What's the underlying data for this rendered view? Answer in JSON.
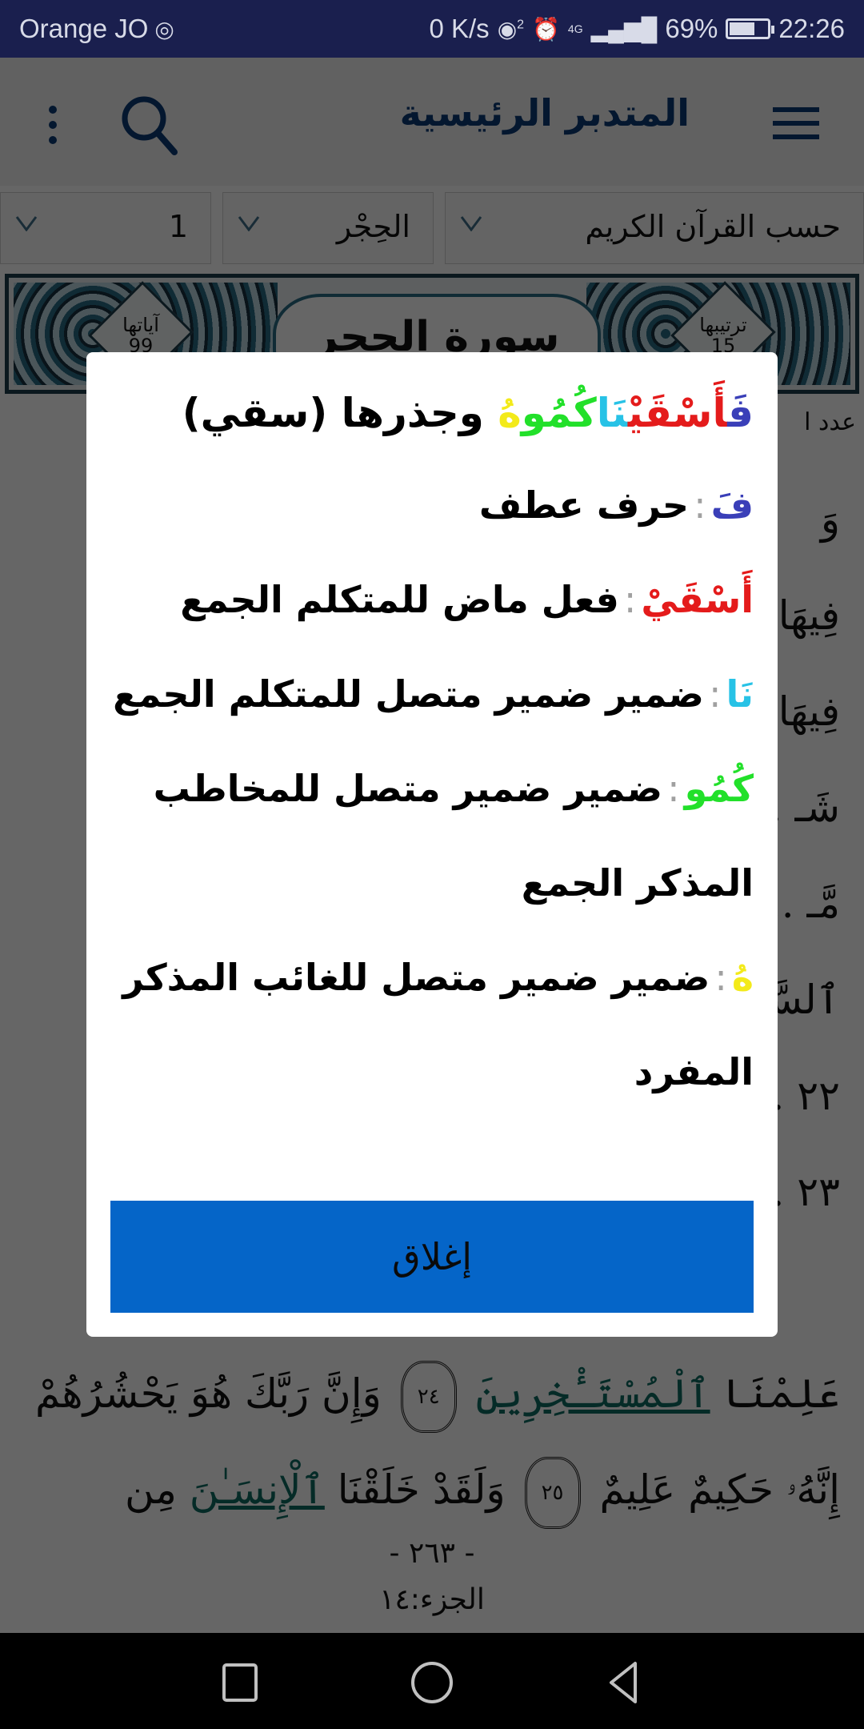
{
  "status_bar": {
    "carrier": "Orange JO",
    "net_speed": "0 K/s",
    "hotspot_count": "2",
    "network_type": "4G",
    "battery_percent": "69%",
    "battery_level": 0.69,
    "time": "22:26"
  },
  "app_bar": {
    "title": "المتدبر الرئيسية",
    "icons": [
      "menu-icon",
      "search-icon",
      "more-vert-icon"
    ]
  },
  "selectors": {
    "mode": "حسب القرآن الكريم",
    "surah": "الحِجْر",
    "number": "1"
  },
  "surah_banner": {
    "title": "سورة الحجر",
    "ayah_count_label": "آياتها",
    "ayah_count": "99",
    "order_label": "ترتيبها",
    "order": "15"
  },
  "page": {
    "info_line": "عدد ا",
    "lines": [
      "وَ",
      "فِيهَا ... كُمْ",
      "فِيهَا ... مِّن",
      "شَـ ... رٍ",
      "مَّـ ... نَ",
      "ٱلسَّـ ... ينَ",
      "٢٢ ... ونَ",
      "٢٣ ... قَدْ"
    ],
    "line_10": {
      "before": "عَلِمْنَا",
      "highlight": "ٱلْمُسْتَـْٔخِرِينَ",
      "ayah_number": "٢٤",
      "after": "وَإِنَّ رَبَّكَ هُوَ يَحْشُرُهُمْ"
    },
    "line_11": {
      "before": "إِنَّهُۥ حَكِيمٌ عَلِيمٌ",
      "ayah_number": "٢٥",
      "middle": "وَلَقَدْ خَلَقْنَا",
      "highlight": "ٱلْإِنسَـٰنَ",
      "after": "مِن"
    },
    "page_number": "- ٢٦٣ -",
    "juz": "الجزء:١٤"
  },
  "dialog": {
    "word_segments": [
      "فَ",
      "أَسْقَيْ",
      "نَا",
      "كُمُو",
      "هُ"
    ],
    "root_text": "وجذرها (سقي)",
    "separator": ":",
    "parts": [
      {
        "segment": "فَ",
        "description": "حرف عطف",
        "color": "#3a3fb8"
      },
      {
        "segment": "أَسْقَيْ",
        "description": "فعل ماض للمتكلم الجمع",
        "color": "#e41b1b"
      },
      {
        "segment": "نَا",
        "description": "ضمير ضمير متصل للمتكلم الجمع",
        "color": "#27c2e6"
      },
      {
        "segment": "كُمُو",
        "description": "ضمير ضمير متصل للمخاطب المذكر الجمع",
        "color": "#22e02a"
      },
      {
        "segment": "هُ",
        "description": "ضمير ضمير متصل للغائب المذكر المفرد",
        "color": "#f3ea1a"
      }
    ],
    "close_label": "إغلاق",
    "close_color": "#0565c8"
  },
  "nav_bar": {
    "buttons": [
      "recents",
      "home",
      "back"
    ]
  }
}
